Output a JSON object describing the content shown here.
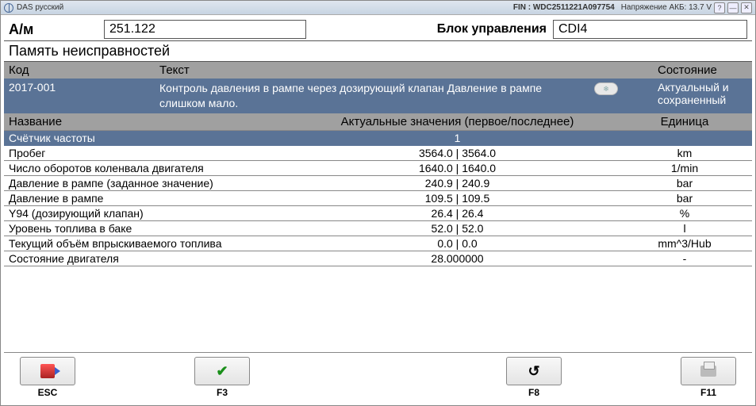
{
  "titlebar": {
    "app_name": "DAS русский",
    "fin_label": "FIN : WDC2511221A097754",
    "voltage_label": "Напряжение АКБ: 13.7 V"
  },
  "top": {
    "am_label": "А/м",
    "am_value": "251.122",
    "ecu_label": "Блок управления",
    "ecu_value": "CDI4"
  },
  "section_title": "Память неисправностей",
  "fault_headers": {
    "code": "Код",
    "text": "Текст",
    "state": "Состояние"
  },
  "fault": {
    "code": "2017-001",
    "text": "Контроль давления в рампе через дозирующий клапан Давление в рампе слишком мало.",
    "state": "Актуальный и сохраненный"
  },
  "data_headers": {
    "name": "Название",
    "value": "Актуальные значения (первое/последнее)",
    "unit": "Единица"
  },
  "rows": [
    {
      "name": "Счётчик частоты",
      "value": "1",
      "unit": "",
      "hi": true
    },
    {
      "name": "Пробег",
      "value": "3564.0 | 3564.0",
      "unit": "km"
    },
    {
      "name": "Число оборотов коленвала двигателя",
      "value": "1640.0 | 1640.0",
      "unit": "1/min"
    },
    {
      "name": "Давление в рампе (заданное значение)",
      "value": "240.9 | 240.9",
      "unit": "bar"
    },
    {
      "name": "Давление в рампе",
      "value": "109.5 | 109.5",
      "unit": "bar"
    },
    {
      "name": "Y94 (дозирующий клапан)",
      "value": "26.4 | 26.4",
      "unit": "%"
    },
    {
      "name": "Уровень топлива в баке",
      "value": "52.0 | 52.0",
      "unit": "l"
    },
    {
      "name": "Текущий объём впрыскиваемого топлива",
      "value": "0.0 | 0.0",
      "unit": "mm^3/Hub"
    },
    {
      "name": "Состояние двигателя",
      "value": "28.000000",
      "unit": "-"
    }
  ],
  "footer": {
    "esc": "ESC",
    "f3": "F3",
    "f8": "F8",
    "f11": "F11"
  }
}
